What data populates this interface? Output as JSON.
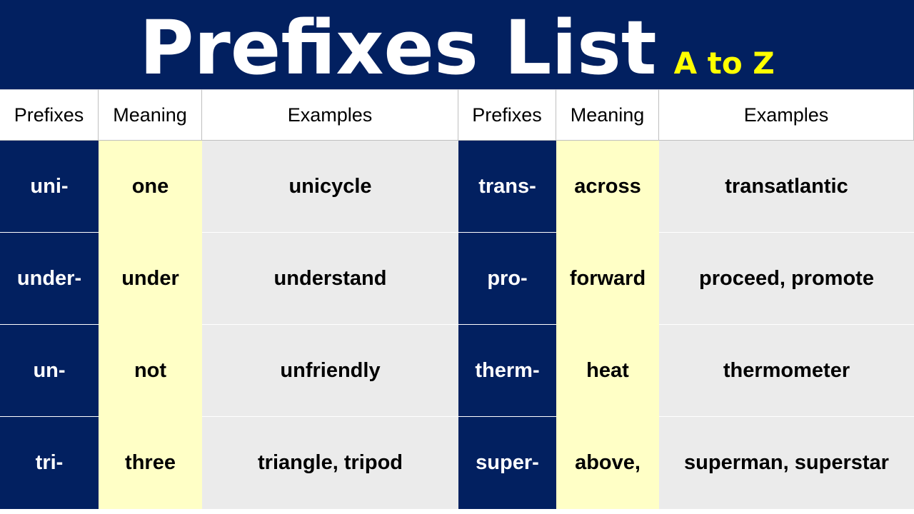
{
  "banner": {
    "title": "Prefixes List",
    "subtitle": "A to Z"
  },
  "colors": {
    "navy": "#022060",
    "yellow_text": "#ffff00",
    "meaning_bg": "#ffffc6",
    "examples_bg": "#ebebeb"
  },
  "left_table": {
    "headers": [
      "Prefixes",
      "Meaning",
      "Examples"
    ],
    "rows": [
      {
        "prefix": "uni-",
        "meaning": "one",
        "examples": "unicycle"
      },
      {
        "prefix": "under-",
        "meaning": "under",
        "examples": "understand"
      },
      {
        "prefix": "un-",
        "meaning": "not",
        "examples": "unfriendly"
      },
      {
        "prefix": "tri-",
        "meaning": "three",
        "examples": "triangle, tripod"
      }
    ]
  },
  "right_table": {
    "headers": [
      "Prefixes",
      "Meaning",
      "Examples"
    ],
    "rows": [
      {
        "prefix": "trans-",
        "meaning": "across",
        "examples": "transatlantic"
      },
      {
        "prefix": "pro-",
        "meaning": "forward",
        "examples": "proceed, promote"
      },
      {
        "prefix": "therm-",
        "meaning": "heat",
        "examples": "thermometer"
      },
      {
        "prefix": "super-",
        "meaning": "above,",
        "examples": "superman, superstar"
      }
    ]
  }
}
